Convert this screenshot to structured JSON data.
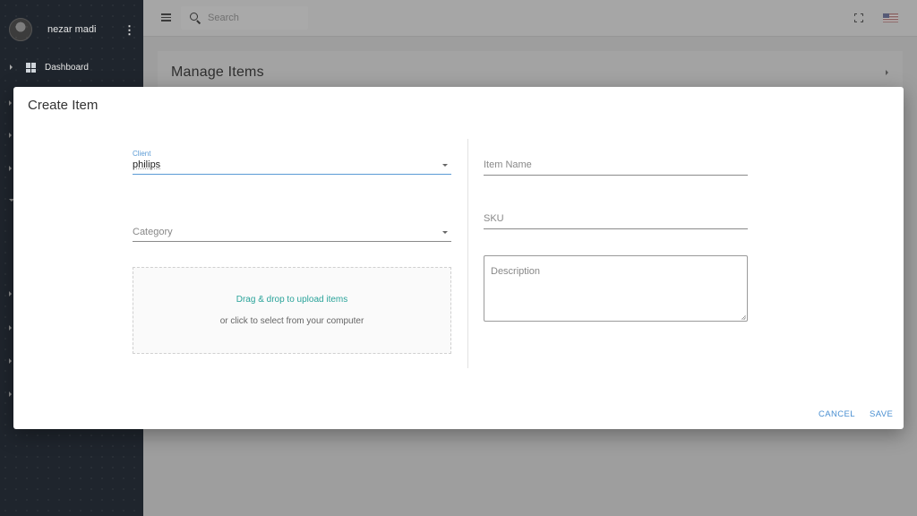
{
  "sidebar": {
    "user_name": "nezar madi",
    "nav": [
      {
        "label": "Dashboard",
        "icon": "dashboard-icon"
      }
    ]
  },
  "topbar": {
    "search_placeholder": "Search",
    "icons": [
      "menu-icon",
      "search-icon",
      "fullscreen-icon",
      "us-flag-icon"
    ]
  },
  "page": {
    "title": "Manage Items"
  },
  "modal": {
    "title": "Create Item",
    "client": {
      "label": "Client",
      "value": "philips"
    },
    "category": {
      "placeholder": "Category"
    },
    "upload": {
      "main_text": "Drag & drop to upload items",
      "sub_text": "or click to select from your computer"
    },
    "item_name": {
      "placeholder": "Item Name"
    },
    "sku": {
      "placeholder": "SKU"
    },
    "description": {
      "placeholder": "Description"
    },
    "actions": {
      "cancel": "CANCEL",
      "save": "SAVE"
    }
  },
  "colors": {
    "accent": "#5b9bd5",
    "upload_text": "#2aa39a",
    "sidebar_bg": "#1f252d"
  }
}
